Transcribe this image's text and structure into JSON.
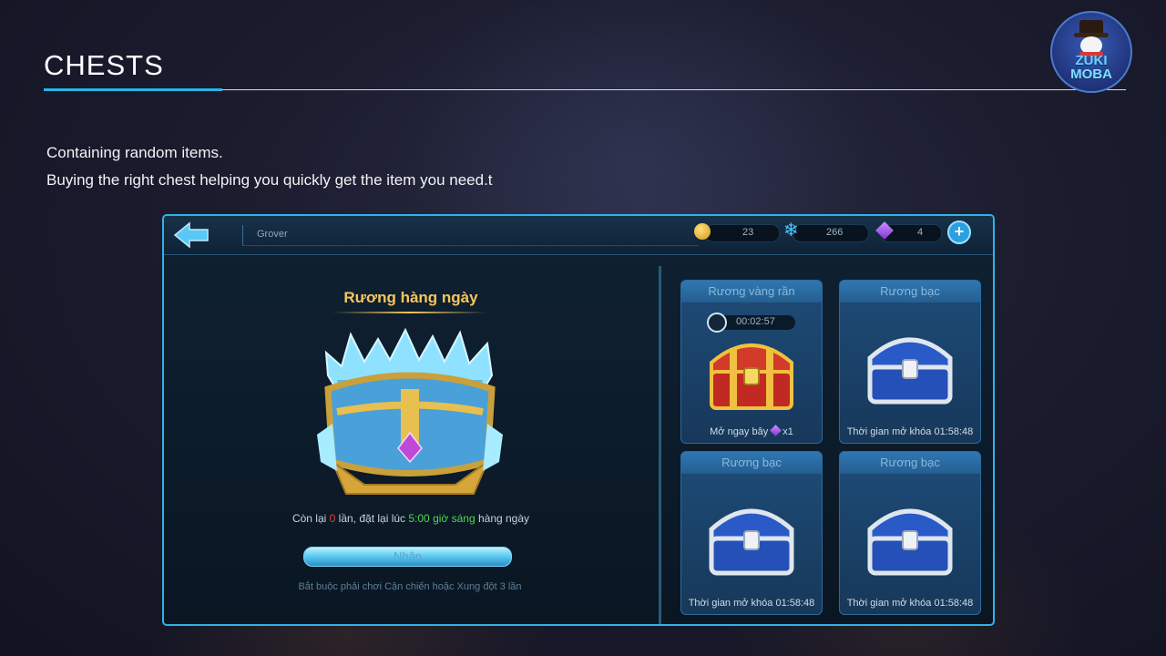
{
  "page": {
    "title": "CHESTS",
    "description": [
      "Containing random items.",
      "Buying the right chest helping you quickly get the item you need.t"
    ],
    "logo_text": [
      "ZUKI",
      "MOBA"
    ]
  },
  "game": {
    "player_name": "Grover",
    "currency": {
      "gold": "23",
      "snowflake": "266",
      "gem": "4"
    },
    "daily_chest": {
      "title": "Rương hàng ngày",
      "info_prefix": "Còn lại ",
      "remaining": "0",
      "info_mid": " lần, đặt lại lúc ",
      "reset_time": "5:00 giờ sáng",
      "info_suffix": " hàng ngày",
      "claim_label": "Nhận",
      "requirement": "Bắt buộc phải chơi Cận chiến hoặc Xung đột 3 lần"
    },
    "chest_cards": [
      {
        "title": "Rương vàng rần",
        "timer": "00:02:57",
        "footer": "Mở ngay bây",
        "footer_count": "x1",
        "type": "gold"
      },
      {
        "title": "Rương bạc",
        "footer": "Thời gian mở khóa 01:58:48",
        "type": "silver"
      },
      {
        "title": "Rương bạc",
        "footer": "Thời gian mở khóa 01:58:48",
        "type": "silver"
      },
      {
        "title": "Rương bạc",
        "footer": "Thời gian mở khóa 01:58:48",
        "type": "silver"
      }
    ]
  },
  "colors": {
    "accent": "#28b4e6",
    "gold_text": "#f6c65a",
    "red": "#e23c3c",
    "green": "#52d64e"
  }
}
